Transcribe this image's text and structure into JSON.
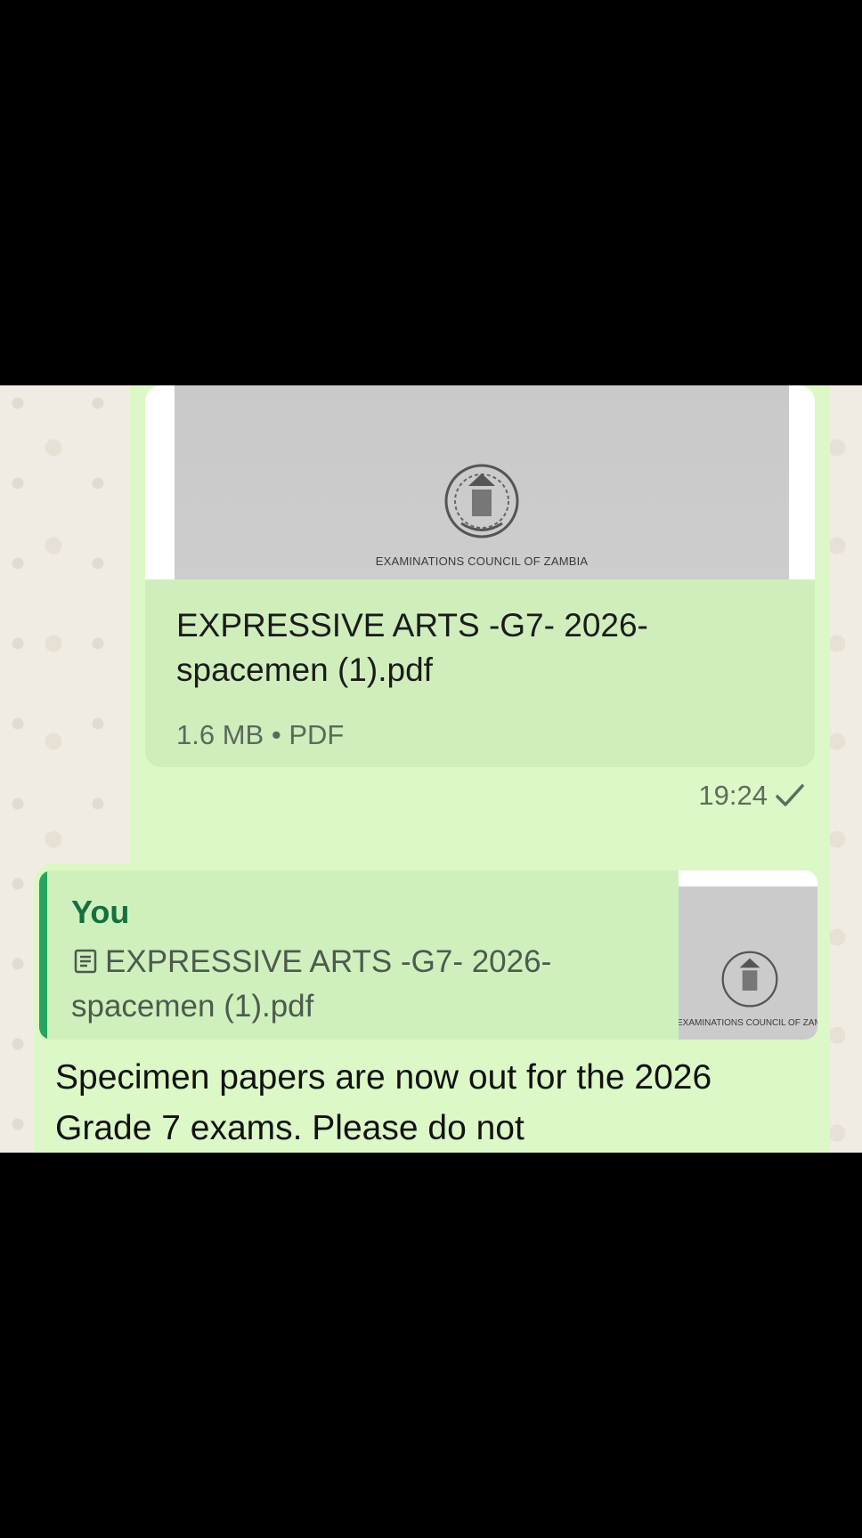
{
  "message_document": {
    "preview_caption": "EXAMINATIONS COUNCIL OF ZAMBIA",
    "file_name": "EXPRESSIVE ARTS -G7- 2026-spacemen  (1).pdf",
    "file_size": "1.6 MB",
    "file_type": "PDF",
    "timestamp": "19:24",
    "status_icon": "single-check-icon"
  },
  "reply_message": {
    "quote_author": "You",
    "quote_icon": "document-icon",
    "quote_text": "EXPRESSIVE ARTS -G7- 2026-spacemen  (1).pdf",
    "quote_thumb_caption": "EXAMINATIONS COUNCIL OF ZAMBIA",
    "body_text": "Specimen papers are now out for the 2026 Grade 7 exams. Please do not"
  },
  "colors": {
    "bubble": "#dcf8c6",
    "quote_bar": "#25a55f",
    "author": "#14703f",
    "chat_background": "#f1ece3"
  }
}
